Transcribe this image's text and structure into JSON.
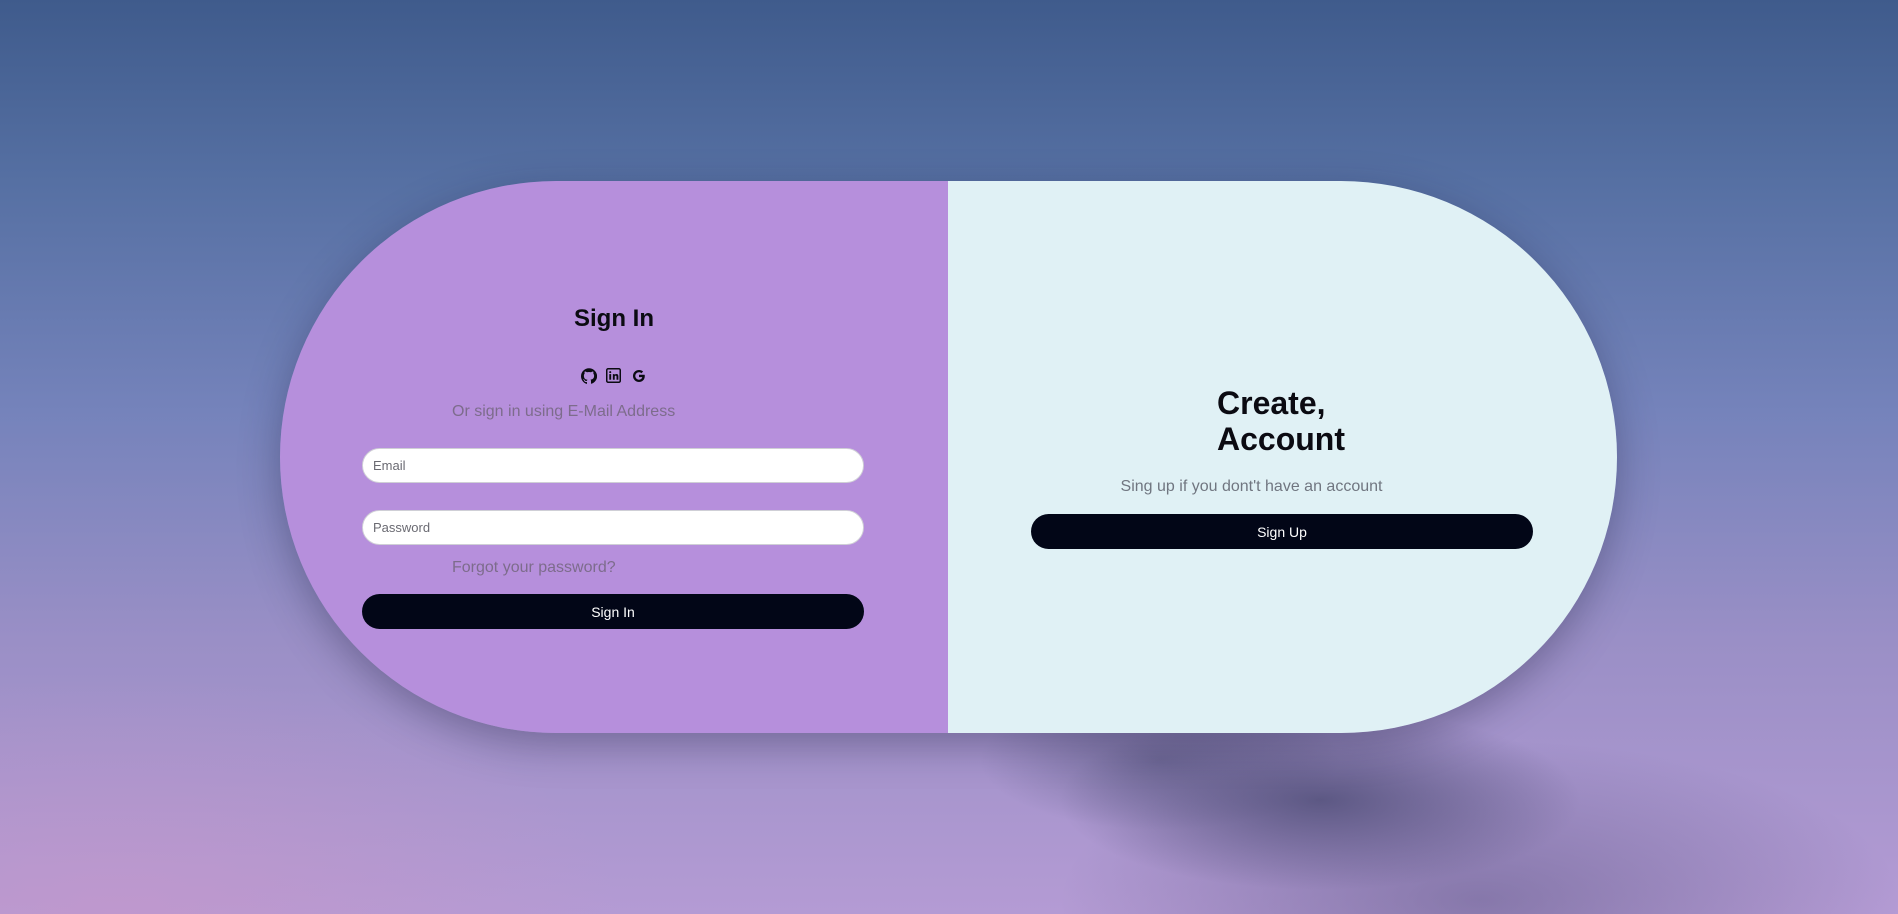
{
  "signin": {
    "title": "Sign In",
    "social_icons": [
      "github-icon",
      "linkedin-icon",
      "google-icon"
    ],
    "subtitle": "Or sign in using E-Mail Address",
    "email_placeholder": "Email",
    "password_placeholder": "Password",
    "forgot_label": "Forgot your password?",
    "button_label": "Sign In"
  },
  "signup": {
    "title_line1": "Create,",
    "title_line2": "Account",
    "subtitle": "Sing up if you dont't have an account",
    "button_label": "Sign Up"
  },
  "colors": {
    "left_panel": "#b68fdc",
    "right_panel": "#e0f1f5",
    "button": "#020617"
  }
}
